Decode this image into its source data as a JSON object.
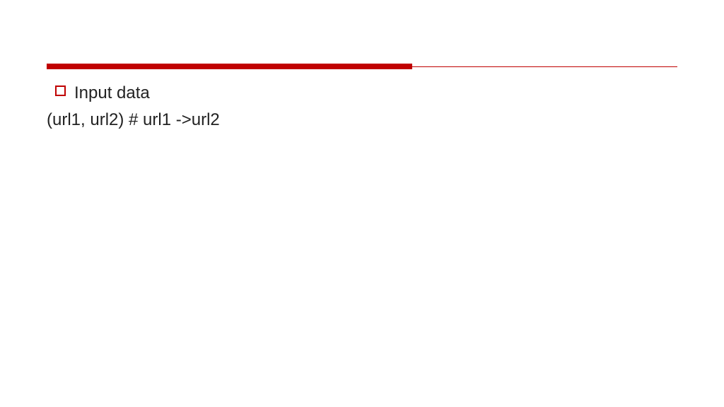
{
  "colors": {
    "accent": "#c00000"
  },
  "content": {
    "bullet_label": "Input data",
    "body_line": "(url1, url2) # url1 ->url2"
  }
}
